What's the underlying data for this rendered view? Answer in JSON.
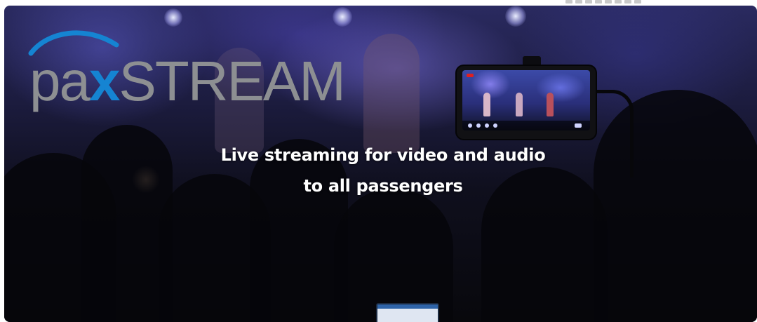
{
  "logo": {
    "part1": "pa",
    "part2": "x",
    "part3": "STREAM",
    "brand_gray": "#8d8f92",
    "brand_blue": "#1584d2"
  },
  "hero": {
    "headline_line1": "Live streaming for video and audio",
    "headline_line2": "to all passengers",
    "background_image": "concert-crowd-photo",
    "phone_icon": "smartphone-recording-icon"
  },
  "colors": {
    "headline": "#ffffff",
    "rec_indicator": "#e02020"
  }
}
